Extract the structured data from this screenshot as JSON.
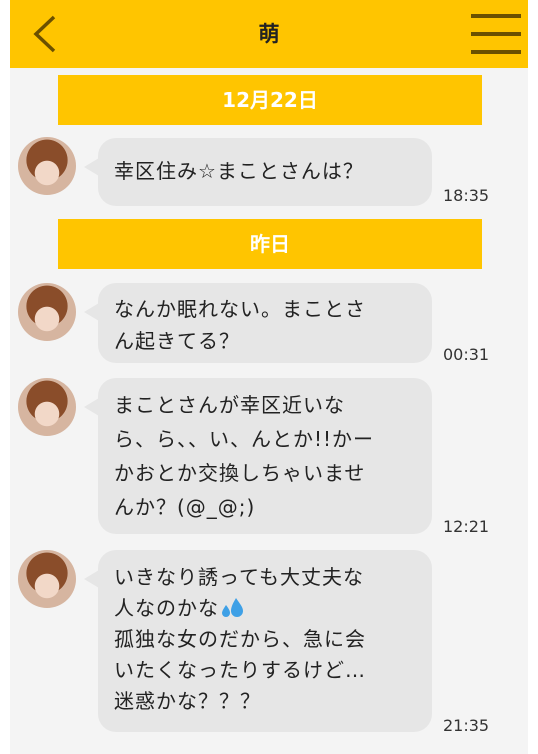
{
  "header": {
    "title": "萌",
    "back_icon": "chevron-left-icon",
    "menu_icon": "hamburger-menu-icon"
  },
  "colors": {
    "accent": "#ffc500",
    "bubble": "#e6e6e6",
    "background": "#f4f4f4"
  },
  "dates": [
    "12月22日",
    "昨日"
  ],
  "messages": [
    {
      "lines": [
        "幸区住み☆まことさんは？"
      ],
      "time": "18:35"
    },
    {
      "lines": [
        "なんか眠れない。まことさ",
        "ん起きてる？"
      ],
      "time": "00:31"
    },
    {
      "lines": [
        "まことさんが幸区近いな",
        "ら、ら、、い、んとか!!かー",
        "かおとか交換しちゃいませ",
        "んか？(@_@;)"
      ],
      "time": "12:21"
    },
    {
      "lines": [
        "いきなり誘っても大丈夫な",
        "人なのかな",
        "孤独な女のだから、急に会",
        "いたくなったりするけど…",
        "迷惑かな？？？"
      ],
      "time": "21:35",
      "emoji": "sweat-drops-icon"
    }
  ]
}
